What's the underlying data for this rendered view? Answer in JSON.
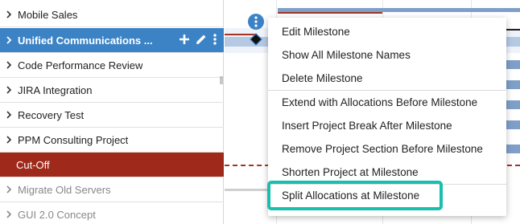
{
  "sidebar": {
    "rows": [
      {
        "label": "Mobile Sales"
      },
      {
        "label": "Unified Communications ..."
      },
      {
        "label": "Code Performance Review"
      },
      {
        "label": "JIRA Integration"
      },
      {
        "label": "Recovery Test"
      },
      {
        "label": "PPM Consulting Project"
      },
      {
        "label": "Cut-Off"
      },
      {
        "label": "Migrate Old Servers"
      },
      {
        "label": "GUI 2.0 Concept"
      }
    ]
  },
  "context_menu": {
    "items": [
      "Edit Milestone",
      "Show All Milestone Names",
      "Delete Milestone",
      "Extend with Allocations Before Milestone",
      "Insert Project Break After Milestone",
      "Remove Project Section Before Milestone",
      "Shorten Project at Milestone",
      "Split Allocations at Milestone"
    ]
  },
  "colors": {
    "selected_row": "#3c83c5",
    "cutoff_row": "#9f2a1c",
    "highlight": "#19bfae",
    "milestone_marker": "#3c83c5"
  },
  "icons": [
    "chevron-right-icon",
    "plus-icon",
    "pencil-icon",
    "more-vertical-icon",
    "diamond-icon"
  ]
}
